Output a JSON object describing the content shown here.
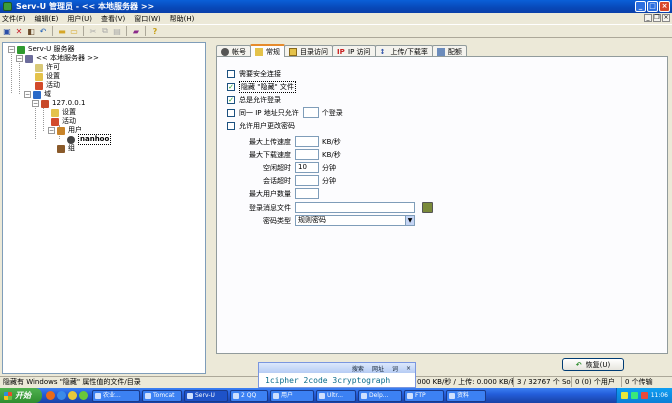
{
  "window": {
    "title": "Serv-U 管理员 - << 本地服务器 >>",
    "min": "_",
    "max": "□",
    "close": "×"
  },
  "menu": {
    "items": [
      "文件(F)",
      "编辑(E)",
      "用户(U)",
      "查看(V)",
      "窗口(W)",
      "帮助(H)"
    ]
  },
  "tree": {
    "root": "Serv-U 服务器",
    "local": "<< 本地服务器 >>",
    "license": "许可",
    "settings": "设置",
    "activity": "活动",
    "domains": "域",
    "domain_ip": "127.0.0.1",
    "d_settings": "设置",
    "d_activity": "活动",
    "users": "用户",
    "user": "nanhoo",
    "groups": "组"
  },
  "tabs": [
    "帐号",
    "常规",
    "目录访问",
    "IP 访问",
    "上传/下载率",
    "配额"
  ],
  "general": {
    "require_secure": {
      "label": "需要安全连接",
      "checked": false
    },
    "hide_hidden": {
      "label": "隐藏 \"隐藏\" 文件",
      "checked": true
    },
    "always_allow": {
      "label": "总是允许登录",
      "checked": true
    },
    "same_ip": {
      "label": "同一 IP 地址只允许",
      "checked": false,
      "value": "",
      "suffix": "个登录"
    },
    "allow_change_pw": {
      "label": "允许用户更改密码",
      "checked": false
    },
    "max_upload": {
      "label": "最大上传速度",
      "value": "",
      "unit": "KB/秒"
    },
    "max_download": {
      "label": "最大下载速度",
      "value": "",
      "unit": "KB/秒"
    },
    "idle_timeout": {
      "label": "空闲超时",
      "value": "10",
      "unit": "分钟"
    },
    "session_timeout": {
      "label": "会话超时",
      "value": "",
      "unit": "分钟"
    },
    "max_users": {
      "label": "最大用户数量",
      "value": ""
    },
    "login_msg": {
      "label": "登录消息文件",
      "value": ""
    },
    "pw_type": {
      "label": "密码类型",
      "value": "规则密码"
    },
    "restore": "恢复(U)"
  },
  "status": {
    "hint": "隐藏有 Windows \"隐藏\" 属性值的文件/目录",
    "rate": "000 KB/秒 / 上传: 0.000 KB/秒",
    "sockets": "3 / 32767 个 Socket",
    "users": "0 (0) 个用户",
    "transfers": "0 个传输"
  },
  "popup": {
    "search": "搜索",
    "web": "网址",
    "word": "词",
    "text": "1cipher 2code 3cryptograph"
  },
  "taskbar": {
    "start": "开始",
    "tasks": [
      "农业...",
      "Tomcat",
      "Serv-U",
      "2 QQ",
      "用户",
      "Ultr...",
      "Delp...",
      "FTP",
      "资料"
    ],
    "clock": "11:06"
  }
}
